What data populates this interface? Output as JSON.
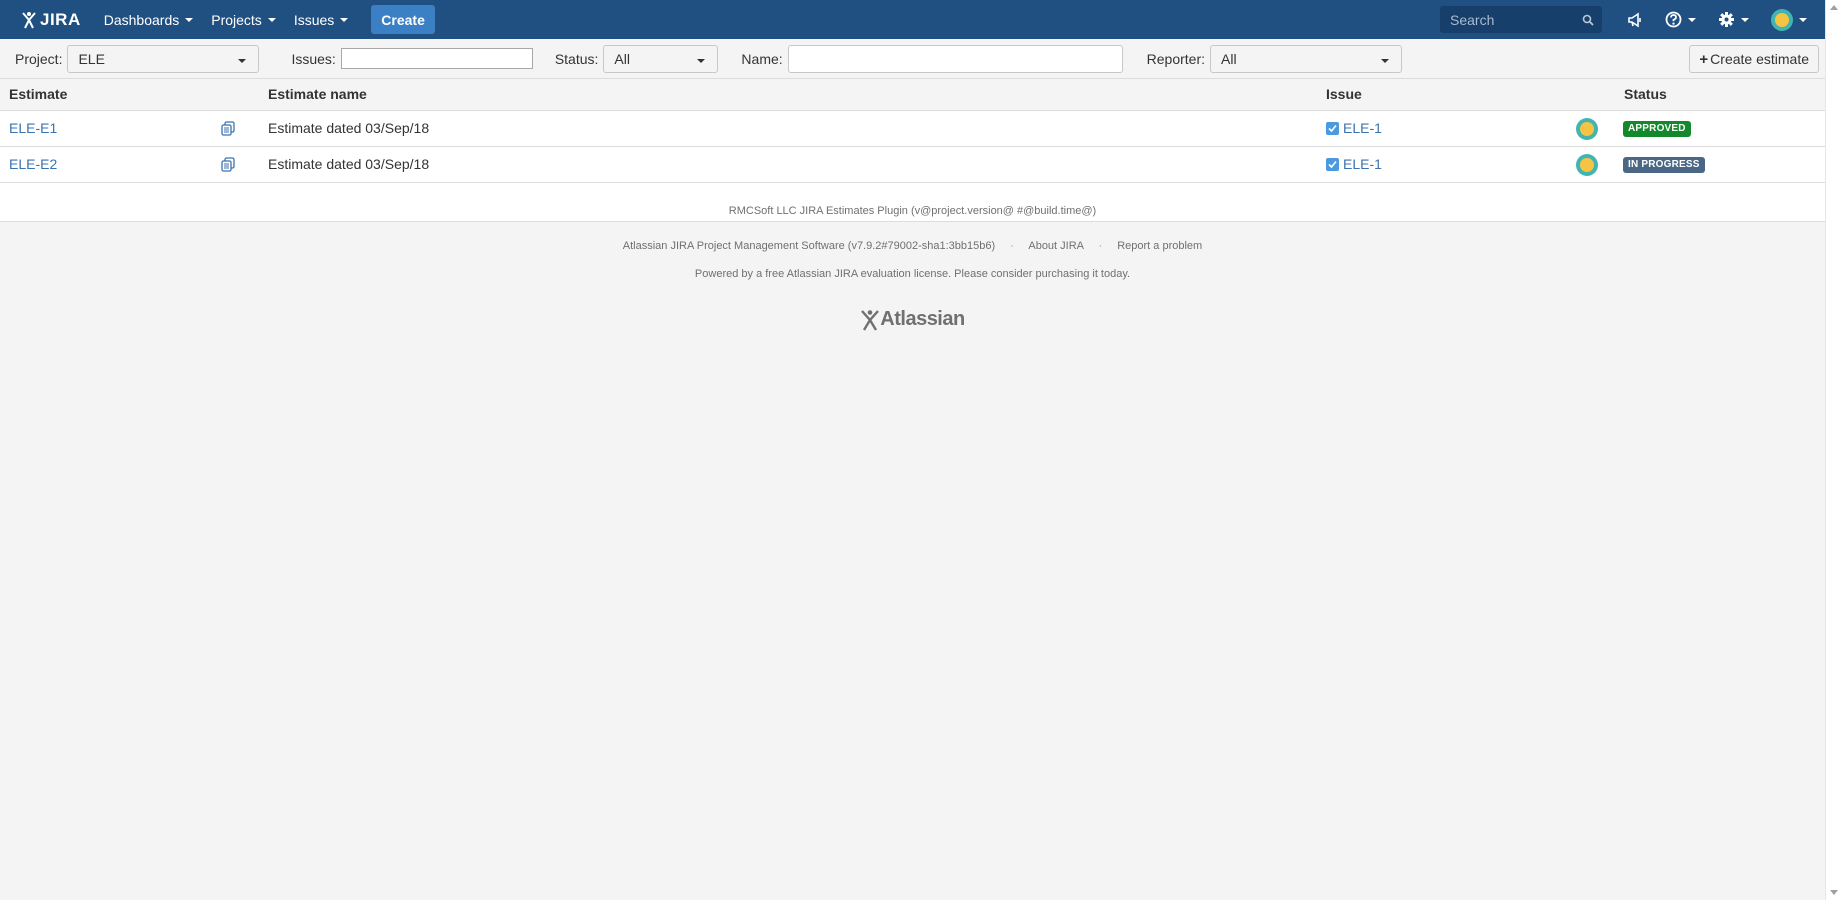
{
  "header": {
    "logo_text": "JIRA",
    "nav": [
      {
        "label": "Dashboards"
      },
      {
        "label": "Projects"
      },
      {
        "label": "Issues"
      }
    ],
    "create_label": "Create",
    "search_placeholder": "Search",
    "brand_color": "#205081"
  },
  "filters": {
    "project_label": "Project:",
    "project_value": "ELE",
    "issues_label": "Issues:",
    "issues_value": "",
    "status_label": "Status:",
    "status_value": "All",
    "name_label": "Name:",
    "name_value": "",
    "reporter_label": "Reporter:",
    "reporter_value": "All",
    "create_estimate_label": "Create estimate"
  },
  "table": {
    "columns": [
      "Estimate",
      "Estimate name",
      "Issue",
      "Status"
    ],
    "rows": [
      {
        "estimate": "ELE-E1",
        "name": "Estimate dated 03/Sep/18",
        "issue": "ELE-1",
        "status": "APPROVED",
        "status_color": "#14892c"
      },
      {
        "estimate": "ELE-E2",
        "name": "Estimate dated 03/Sep/18",
        "issue": "ELE-1",
        "status": "IN PROGRESS",
        "status_color": "#4a6785"
      }
    ],
    "plugin_footer": "RMCSoft LLC JIRA Estimates Plugin (v@project.version@ #@build.time@)"
  },
  "footer": {
    "software": "Atlassian JIRA Project Management Software (v7.9.2#79002-sha1:3bb15b6)",
    "about": "About JIRA",
    "report": "Report a problem",
    "license": "Powered by a free Atlassian JIRA evaluation license. Please consider purchasing it today.",
    "atlassian_logo_text": "Atlassian"
  }
}
